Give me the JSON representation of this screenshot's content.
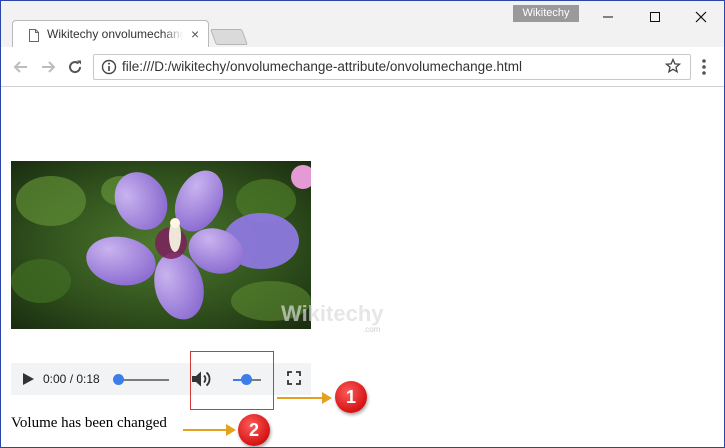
{
  "browser": {
    "tab_title": "Wikitechy onvolumechange",
    "tab_close": "×",
    "profile_name": "Wikitechy",
    "url": "file:///D:/wikitechy/onvolumechange-attribute/onvolumechange.html"
  },
  "media": {
    "audio_time": "0:00 / 0:18",
    "seek_progress": 0.0,
    "volume_level": 0.5
  },
  "page": {
    "status_message": "Volume has been changed",
    "watermark": "Wikitechy",
    "watermark_sub": ".com"
  },
  "annotations": {
    "badge_1": "1",
    "badge_2": "2"
  },
  "colors": {
    "accent": "#3c7dea",
    "highlight": "#d23a3a",
    "arrow": "#e6a020",
    "badge": "#d41414"
  },
  "icons": [
    "file-icon",
    "close-icon",
    "minimize-icon",
    "maximize-icon",
    "back-icon",
    "forward-icon",
    "reload-icon",
    "info-icon",
    "star-icon",
    "menu-icon",
    "play-icon",
    "volume-icon",
    "fullscreen-icon"
  ]
}
